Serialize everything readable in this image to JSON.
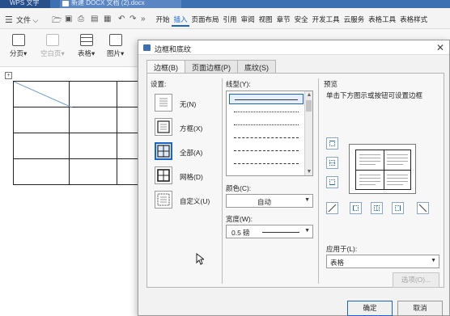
{
  "window": {
    "app_tab": "WPS 文字",
    "doc_tab": "新建 DOCX 文档 (2).docx"
  },
  "menubar": {
    "file_label": "文件",
    "tabs": [
      "开始",
      "插入",
      "页面布局",
      "引用",
      "审阅",
      "视图",
      "章节",
      "安全",
      "开发工具",
      "云服务",
      "表格工具",
      "表格样式"
    ],
    "active_tab": "插入"
  },
  "ribbon": {
    "items": [
      {
        "label": "分页",
        "icon": "page-break-icon"
      },
      {
        "label": "空白页",
        "icon": "blank-page-icon",
        "disabled": true
      },
      {
        "label": "表格",
        "icon": "table-icon"
      },
      {
        "label": "图片",
        "icon": "picture-icon"
      }
    ]
  },
  "dialog": {
    "title": "边框和底纹",
    "tabs": [
      "边框(B)",
      "页面边框(P)",
      "底纹(S)"
    ],
    "active_tab": "边框(B)",
    "settings_label": "设置:",
    "settings": [
      {
        "label": "无(N)",
        "icon": "border-none-icon"
      },
      {
        "label": "方框(X)",
        "icon": "border-box-icon"
      },
      {
        "label": "全部(A)",
        "icon": "border-all-icon",
        "selected": true
      },
      {
        "label": "网格(D)",
        "icon": "border-grid-icon"
      },
      {
        "label": "自定义(U)",
        "icon": "border-custom-icon"
      }
    ],
    "line_style_label": "线型(Y):",
    "color_label": "颜色(C):",
    "color_value": "自动",
    "width_label": "宽度(W):",
    "width_value": "0.5 磅",
    "preview_label": "预览",
    "preview_hint": "单击下方图示或按钮可设置边框",
    "apply_to_label": "应用于(L):",
    "apply_to_value": "表格",
    "options_button": "选项(O)...",
    "ok_button": "确定",
    "cancel_button": "取消"
  },
  "colors": {
    "accent": "#1a63c7",
    "title_bar": "#3d6fb3"
  }
}
